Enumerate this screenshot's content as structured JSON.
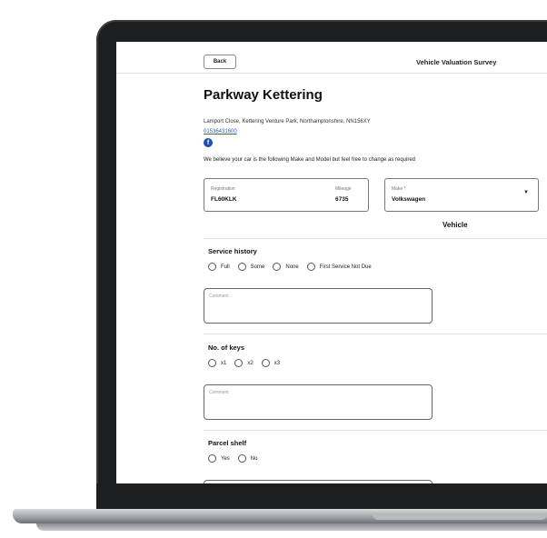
{
  "header": {
    "back_label": "Back",
    "survey_title": "Vehicle Valuation Survey"
  },
  "dealer": {
    "name": "Parkway Kettering",
    "address": "Lamport Close, Kettering Venture Park, Northamptonshire, NN156XY",
    "phone": "01536431600",
    "social_icon": "facebook-icon"
  },
  "intro_text": "We believe your car is the following Make and Model but feel free to change as required",
  "vehicle": {
    "registration_label": "Registration",
    "registration_value": "FL60KLK",
    "mileage_label": "Mileage",
    "mileage_value": "6735",
    "make_label": "Make *",
    "make_value": "Volkswagen",
    "section_heading": "Vehicle"
  },
  "service_history": {
    "title": "Service history",
    "options": [
      "Full",
      "Some",
      "None",
      "First Service Not Due"
    ],
    "comment_placeholder": "Comment"
  },
  "keys": {
    "title": "No. of keys",
    "options": [
      "x1",
      "x2",
      "x3"
    ],
    "comment_placeholder": "Comment"
  },
  "parcel_shelf": {
    "title": "Parcel shelf",
    "options": [
      "Yes",
      "No"
    ]
  },
  "colors": {
    "link": "#1f63c6",
    "facebook": "#1f4fa8",
    "laptop_bezel": "#1d1e20"
  }
}
